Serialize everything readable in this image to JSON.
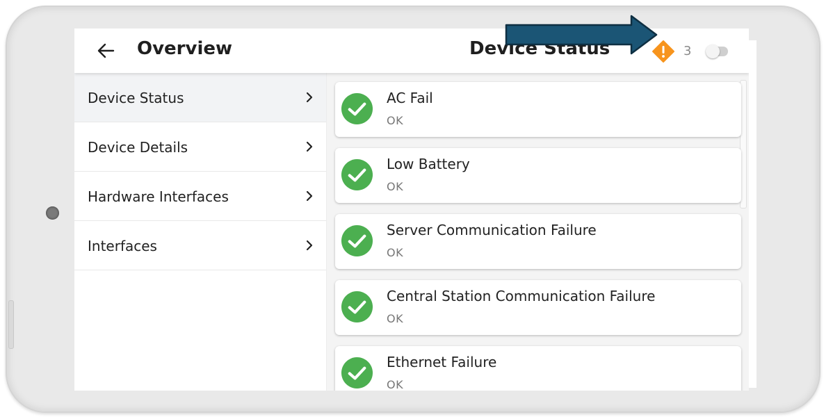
{
  "header": {
    "back_title": "Overview",
    "page_title": "Device Status",
    "warning_count": "3",
    "warning_color": "#f7941d"
  },
  "sidebar": {
    "items": [
      {
        "label": "Device Status",
        "active": true
      },
      {
        "label": "Device Details",
        "active": false
      },
      {
        "label": "Hardware Interfaces",
        "active": false
      },
      {
        "label": "Interfaces",
        "active": false
      }
    ]
  },
  "status_list": [
    {
      "title": "AC Fail",
      "status": "OK"
    },
    {
      "title": "Low Battery",
      "status": "OK"
    },
    {
      "title": "Server Communication Failure",
      "status": "OK"
    },
    {
      "title": "Central Station Communication Failure",
      "status": "OK"
    },
    {
      "title": "Ethernet Failure",
      "status": "OK"
    }
  ],
  "colors": {
    "ok_green": "#4caf50",
    "annotation_arrow": "#1b5575"
  },
  "icons": [
    "back-arrow-icon",
    "warning-diamond-icon",
    "chevron-right-icon",
    "check-circle-icon"
  ]
}
